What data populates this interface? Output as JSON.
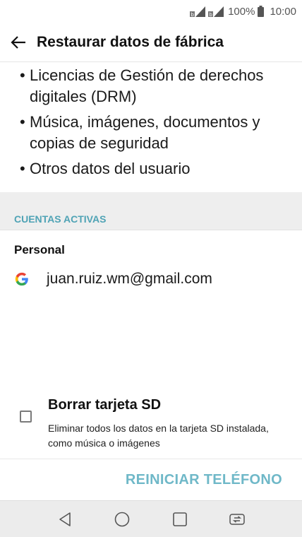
{
  "status_bar": {
    "battery_percent": "100%",
    "time": "10:00"
  },
  "app_bar": {
    "back_icon": "arrow-left-icon",
    "title": "Restaurar datos de fábrica"
  },
  "bullets": [
    "Licencias de Gestión de derechos digitales (DRM)",
    "Música, imágenes, documentos y copias de seguridad",
    "Otros datos del usuario"
  ],
  "accounts": {
    "section_title": "CUENTAS ACTIVAS",
    "group_title": "Personal",
    "items": [
      {
        "icon": "google-icon",
        "email": "juan.ruiz.wm@gmail.com"
      }
    ]
  },
  "sd_option": {
    "checked": false,
    "title": "Borrar tarjeta SD",
    "description": "Eliminar todos los datos en la tarjeta SD instalada, como música o imágenes"
  },
  "action": {
    "reset_label": "REINICIAR TELÉFONO"
  },
  "colors": {
    "accent": "#4fa3b5",
    "button_text": "#6fb8c8",
    "section_bg": "#eeeeee",
    "nav_bg": "#ececec"
  }
}
